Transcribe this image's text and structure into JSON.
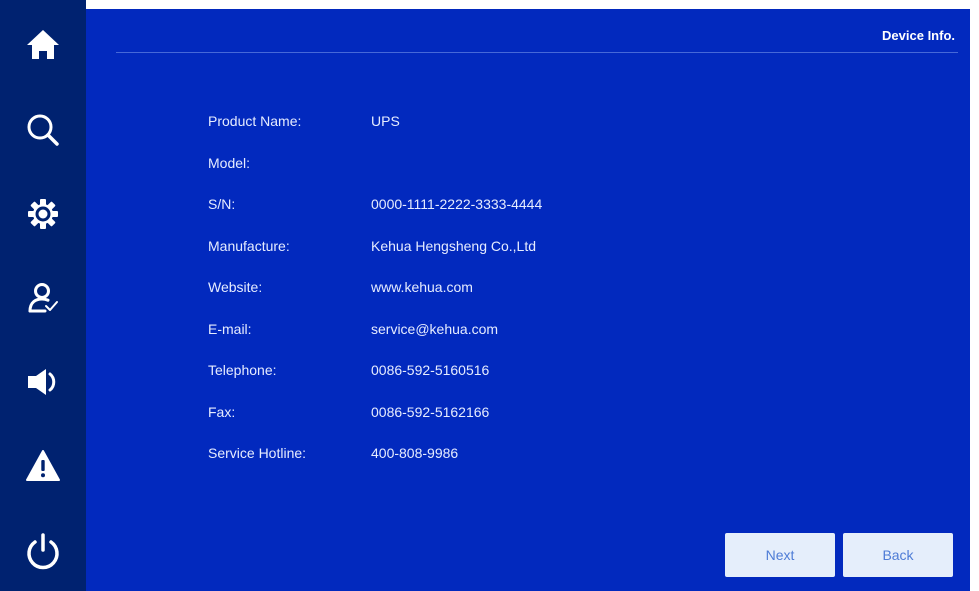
{
  "sidebar": {
    "items": [
      {
        "icon": "home-icon"
      },
      {
        "icon": "search-icon"
      },
      {
        "icon": "gear-icon"
      },
      {
        "icon": "user-check-icon"
      },
      {
        "icon": "speaker-icon"
      },
      {
        "icon": "warning-icon"
      },
      {
        "icon": "power-icon"
      }
    ]
  },
  "header": {
    "title": "Device Info."
  },
  "info": {
    "rows": [
      {
        "label": "Product Name:",
        "value": "UPS"
      },
      {
        "label": "Model:",
        "value": ""
      },
      {
        "label": "S/N:",
        "value": "0000-1111-2222-3333-4444"
      },
      {
        "label": "Manufacture:",
        "value": "Kehua Hengsheng Co.,Ltd"
      },
      {
        "label": "Website:",
        "value": "www.kehua.com"
      },
      {
        "label": "E-mail:",
        "value": "service@kehua.com"
      },
      {
        "label": "Telephone:",
        "value": "0086-592-5160516"
      },
      {
        "label": "Fax:",
        "value": "0086-592-5162166"
      },
      {
        "label": "Service Hotline:",
        "value": "400-808-9986"
      }
    ]
  },
  "buttons": {
    "next": "Next",
    "back": "Back"
  },
  "colors": {
    "sidebar": "#002270",
    "panel": "#0229be",
    "button_bg": "#e5eefb",
    "button_text": "#4e7cd6"
  }
}
